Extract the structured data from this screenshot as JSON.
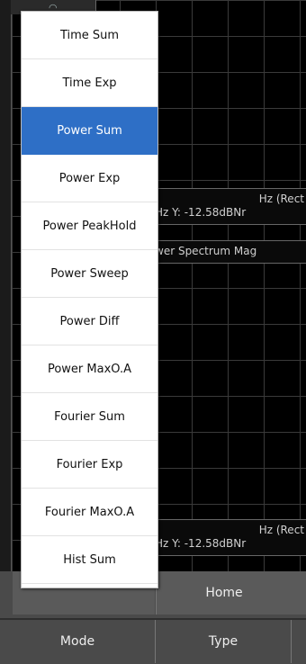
{
  "info_bar_1": {
    "line1": "Hz (Rect",
    "line2": "Hz Y: -12.58dBNr"
  },
  "trace_label": "wer Spectrum Mag",
  "info_bar_2": {
    "line1": "Hz (Rect",
    "line2": "Hz Y: -12.58dBNr"
  },
  "bottom": {
    "row1": {
      "home_label": "Home"
    },
    "row2": {
      "mode_label": "Mode",
      "type_label": "Type"
    }
  },
  "menu": {
    "selected": "Power Sum",
    "items": [
      "Time Sum",
      "Time Exp",
      "Power Sum",
      "Power Exp",
      "Power PeakHold",
      "Power Sweep",
      "Power Diff",
      "Power MaxO.A",
      "Fourier Sum",
      "Fourier Exp",
      "Fourier MaxO.A",
      "Hist Sum"
    ]
  },
  "colors": {
    "selected": "#2e6fc6",
    "grid": "#3a3a3a",
    "bottom": "#4a4a4a"
  }
}
